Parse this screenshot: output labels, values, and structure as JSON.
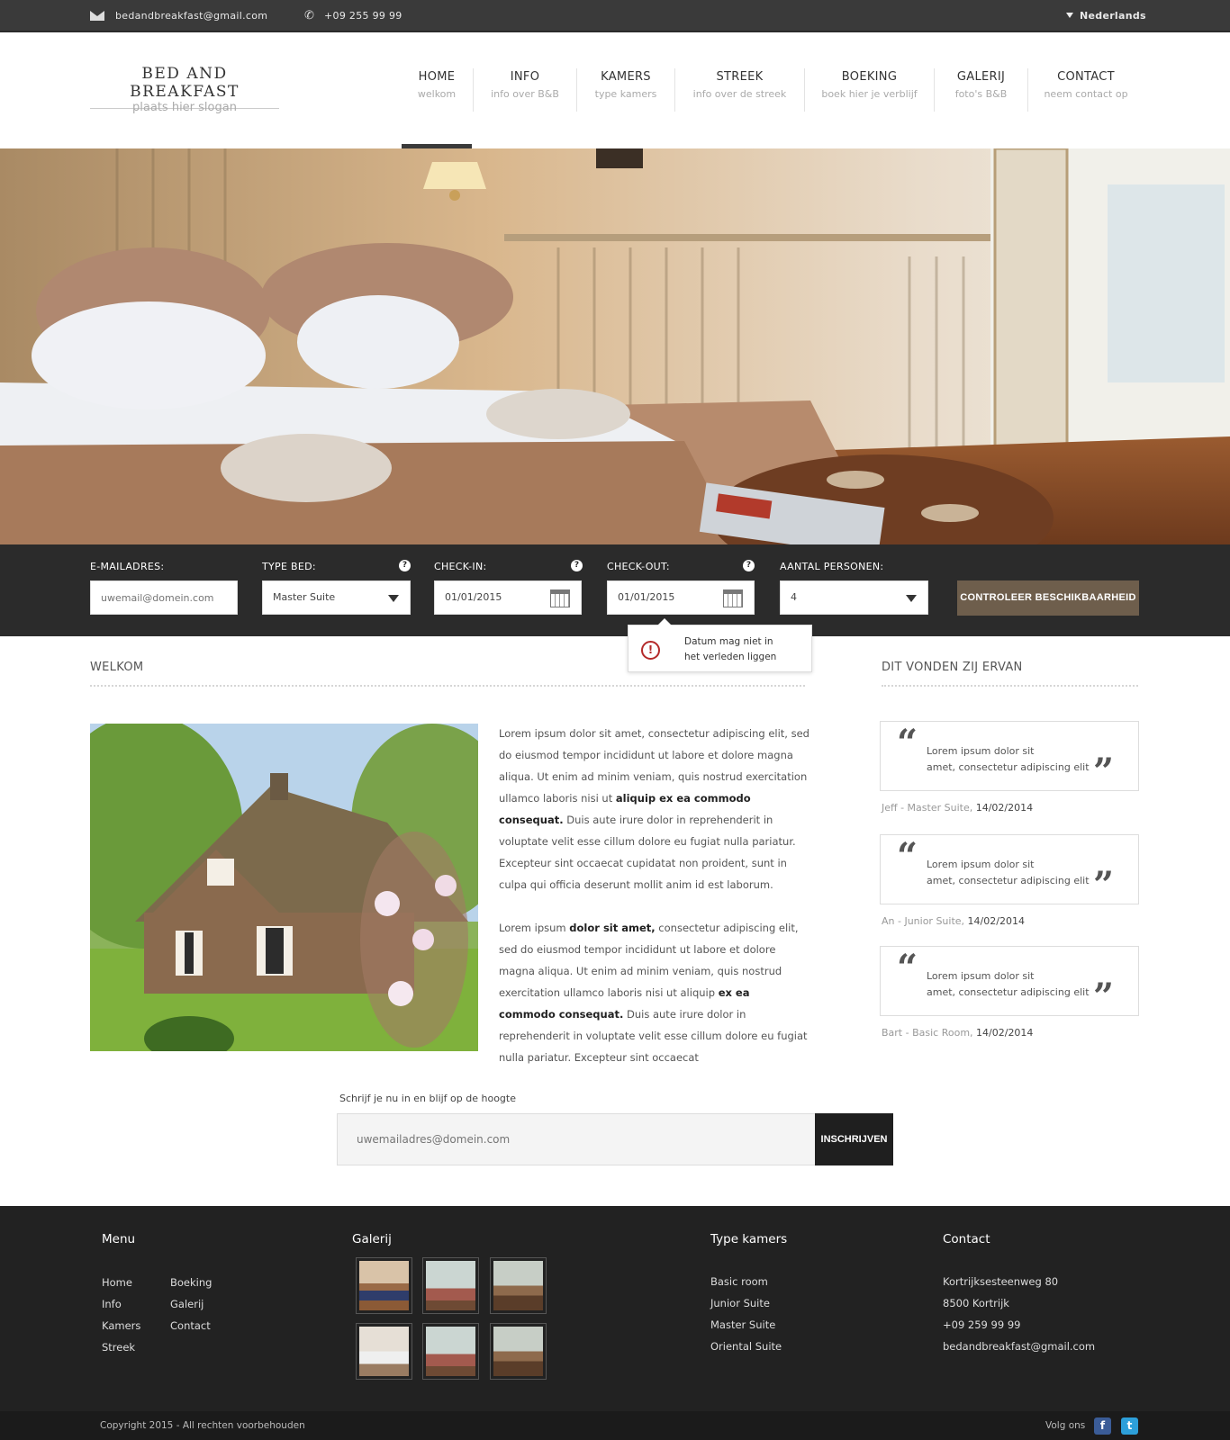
{
  "topbar": {
    "email": "bedandbreakfast@gmail.com",
    "phone": "+09 255 99 99",
    "language": "Nederlands"
  },
  "brand": {
    "logo": "BED AND BREAKFAST",
    "slogan": "plaats hier slogan"
  },
  "nav": [
    {
      "title": "HOME",
      "sub": "welkom"
    },
    {
      "title": "INFO",
      "sub": "info over B&B"
    },
    {
      "title": "KAMERS",
      "sub": "type kamers"
    },
    {
      "title": "STREEK",
      "sub": "info over de streek"
    },
    {
      "title": "BOEKING",
      "sub": "boek hier je verblijf"
    },
    {
      "title": "GALERIJ",
      "sub": "foto's B&B"
    },
    {
      "title": "CONTACT",
      "sub": "neem contact op"
    }
  ],
  "booking": {
    "email_label": "E-MAILADRES:",
    "email_placeholder": "uwemail@domein.com",
    "bed_label": "TYPE BED:",
    "bed_value": "Master Suite",
    "checkin_label": "CHECK-IN:",
    "checkin_value": "01/01/2015",
    "checkout_label": "CHECK-OUT:",
    "checkout_value": "01/01/2015",
    "persons_label": "AANTAL PERSONEN:",
    "persons_value": "4",
    "button": "CONTROLEER BESCHIKBAARHEID",
    "help": "?"
  },
  "tooltip": {
    "line1": "Datum mag niet in",
    "line2": "het verleden liggen"
  },
  "welcome": {
    "title": "WELKOM",
    "p1": [
      {
        "t": "Lorem ipsum dolor sit amet, consectetur adipiscing elit, sed do eiusmod tempor incididunt ut labore et dolore magna aliqua. Ut enim ad minim veniam, quis nostrud exercitation ullamco laboris nisi ut ",
        "b": false
      },
      {
        "t": "aliquip ex ea commodo consequat.",
        "b": true
      },
      {
        "t": " Duis aute irure dolor in reprehenderit in voluptate velit esse cillum dolore eu fugiat nulla pariatur. Excepteur sint occaecat cupidatat non proident, sunt in culpa qui officia deserunt mollit anim id est laborum.",
        "b": false
      }
    ],
    "p2": [
      {
        "t": "Lorem ipsum ",
        "b": false
      },
      {
        "t": "dolor sit amet,",
        "b": true
      },
      {
        "t": " consectetur adipiscing elit, sed do eiusmod tempor incididunt ut labore et dolore magna aliqua. Ut enim ad minim veniam, quis nostrud exercitation ullamco laboris nisi ut aliquip ",
        "b": false
      },
      {
        "t": "ex ea commodo consequat.",
        "b": true
      },
      {
        "t": " Duis aute irure dolor in reprehenderit in voluptate velit esse cillum dolore eu fugiat nulla pariatur. Excepteur sint occaecat",
        "b": false
      }
    ]
  },
  "reviews": {
    "title": "DIT VONDEN ZIJ ERVAN",
    "items": [
      {
        "line1": "Lorem ipsum dolor sit",
        "line2": "amet, consectetur adipiscing elit",
        "author": "Jeff - Master Suite,",
        "date": "14/02/2014"
      },
      {
        "line1": "Lorem ipsum dolor sit",
        "line2": "amet, consectetur adipiscing elit",
        "author": "An - Junior Suite,",
        "date": "14/02/2014"
      },
      {
        "line1": "Lorem ipsum dolor sit",
        "line2": "amet, consectetur adipiscing elit",
        "author": "Bart - Basic Room,",
        "date": "14/02/2014"
      }
    ]
  },
  "newsletter": {
    "label": "Schrijf je nu in en blijf op de hoogte",
    "placeholder": "uwemailadres@domein.com",
    "button": "INSCHRIJVEN"
  },
  "footer": {
    "menu_title": "Menu",
    "menu_col1": [
      "Home",
      "Info",
      "Kamers",
      "Streek"
    ],
    "menu_col2": [
      "Boeking",
      "Galerij",
      "Contact"
    ],
    "gallery_title": "Galerij",
    "rooms_title": "Type kamers",
    "rooms": [
      "Basic room",
      "Junior Suite",
      "Master Suite",
      "Oriental Suite"
    ],
    "contact_title": "Contact",
    "contact": [
      "Kortrijksesteenweg 80",
      "8500 Kortrijk",
      "+09 259 99 99",
      "bedandbreakfast@gmail.com"
    ],
    "copyright": "Copyright 2015 - All rechten voorbehouden",
    "follow": "Volg ons",
    "facebook": "f",
    "twitter": "t"
  }
}
